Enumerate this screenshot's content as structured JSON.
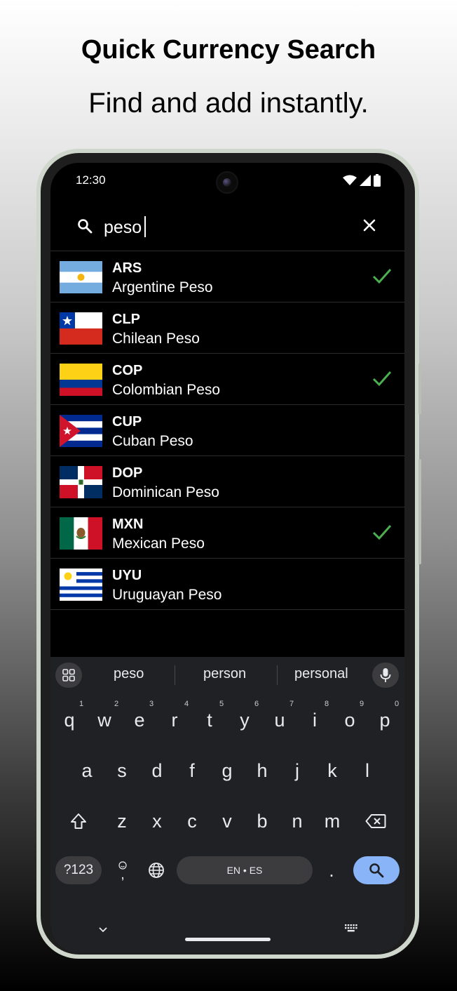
{
  "promo": {
    "title": "Quick Currency Search",
    "subtitle": "Find and add instantly."
  },
  "status_bar": {
    "time": "12:30",
    "icons": [
      "wifi-icon",
      "cellular-signal-icon",
      "battery-icon"
    ]
  },
  "search": {
    "value": "peso",
    "icon": "search-icon",
    "clear_icon": "close-icon"
  },
  "currencies": [
    {
      "code": "ARS",
      "name": "Argentine Peso",
      "flag": "argentina",
      "selected": true
    },
    {
      "code": "CLP",
      "name": "Chilean Peso",
      "flag": "chile",
      "selected": false
    },
    {
      "code": "COP",
      "name": "Colombian Peso",
      "flag": "colombia",
      "selected": true
    },
    {
      "code": "CUP",
      "name": "Cuban Peso",
      "flag": "cuba",
      "selected": false
    },
    {
      "code": "DOP",
      "name": "Dominican Peso",
      "flag": "dominican-republic",
      "selected": false
    },
    {
      "code": "MXN",
      "name": "Mexican Peso",
      "flag": "mexico",
      "selected": true
    },
    {
      "code": "UYU",
      "name": "Uruguayan Peso",
      "flag": "uruguay",
      "selected": false
    }
  ],
  "keyboard": {
    "suggestions": [
      "peso",
      "person",
      "personal"
    ],
    "row1": [
      "q",
      "w",
      "e",
      "r",
      "t",
      "y",
      "u",
      "i",
      "o",
      "p"
    ],
    "row1_hints": [
      "1",
      "2",
      "3",
      "4",
      "5",
      "6",
      "7",
      "8",
      "9",
      "0"
    ],
    "row2": [
      "a",
      "s",
      "d",
      "f",
      "g",
      "h",
      "j",
      "k",
      "l"
    ],
    "row3": [
      "z",
      "x",
      "c",
      "v",
      "b",
      "n",
      "m"
    ],
    "symbols_label": "?123",
    "comma_label": ",",
    "space_label": "EN • ES",
    "period_label": ".",
    "colors": {
      "background": "#202124",
      "key_fill": "#3c3c3f",
      "enter": "#8ab4f8"
    }
  },
  "colors": {
    "check": "#4caf50",
    "screen_background": "#000000",
    "divider": "#2c2c2c"
  }
}
